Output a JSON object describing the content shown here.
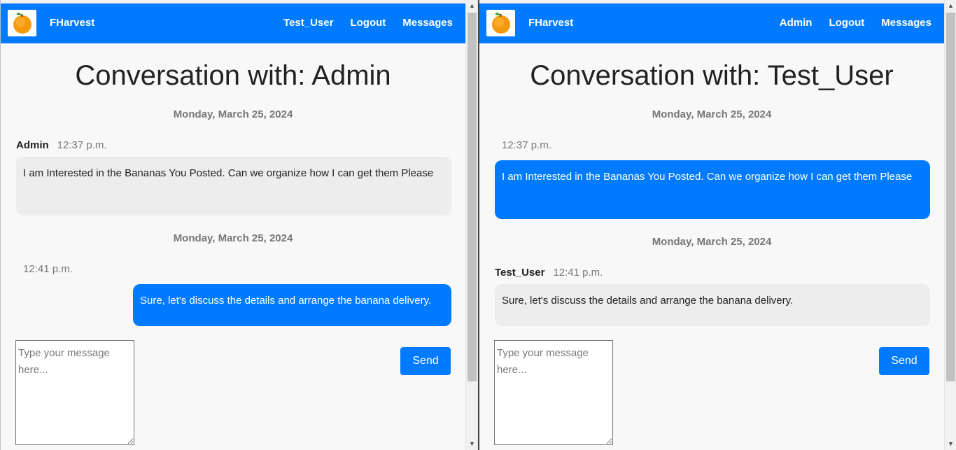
{
  "panes": [
    {
      "nav": {
        "brand": "FHarvest",
        "links": [
          "Test_User",
          "Logout",
          "Messages"
        ]
      },
      "title": "Conversation with: Admin",
      "messages": [
        {
          "date": "Monday, March 25, 2024",
          "sender": "Admin",
          "time": "12:37 p.m.",
          "text": "I am Interested in the Bananas You Posted. Can we organize how I can get them Please"
        },
        {
          "date": "Monday, March 25, 2024",
          "sender": "",
          "time": "12:41 p.m.",
          "text": "Sure, let's discuss the details and arrange the banana delivery."
        }
      ],
      "input": {
        "placeholder": "Type your message here..."
      },
      "send_label": "Send"
    },
    {
      "nav": {
        "brand": "FHarvest",
        "links": [
          "Admin",
          "Logout",
          "Messages"
        ]
      },
      "title": "Conversation with: Test_User",
      "messages": [
        {
          "date": "Monday, March 25, 2024",
          "sender": "",
          "time": "12:37 p.m.",
          "text": "I am Interested in the Bananas You Posted. Can we organize how I can get them Please"
        },
        {
          "date": "Monday, March 25, 2024",
          "sender": "Test_User",
          "time": "12:41 p.m.",
          "text": "Sure, let's discuss the details and arrange the banana delivery."
        }
      ],
      "input": {
        "placeholder": "Type your message here..."
      },
      "send_label": "Send"
    }
  ],
  "colors": {
    "accent": "#007bff",
    "incoming_bubble": "#ededed",
    "muted_text": "#777777"
  },
  "icons": {
    "logo": "orange-fruit-icon",
    "scroll_up": "triangle-up-icon",
    "scroll_down": "triangle-down-icon"
  }
}
